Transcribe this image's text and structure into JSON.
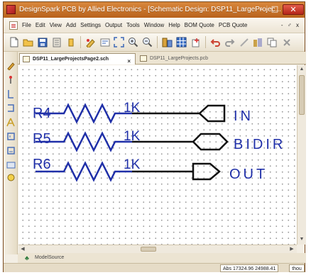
{
  "window": {
    "title": "DesignSpark PCB by Allied Electronics - [Schematic Design: DSP11_LargeProjec...",
    "minimize": "–",
    "maximize": "□",
    "close": "✕"
  },
  "menu": {
    "items": [
      "File",
      "Edit",
      "View",
      "Add",
      "Settings",
      "Output",
      "Tools",
      "Window",
      "Help",
      "BOM Quote",
      "PCB Quote"
    ],
    "mdi_controls": "- ♂ x"
  },
  "tabs": [
    {
      "label": "DSP11_LargeProjectsPage2.sch",
      "close": "×"
    },
    {
      "label": "DSP11_LargeProjects.pcb"
    }
  ],
  "schematic": {
    "resistors": [
      {
        "ref": "R4",
        "value": "1K",
        "port": "IN"
      },
      {
        "ref": "R5",
        "value": "1K",
        "port": "BIDIR"
      },
      {
        "ref": "R6",
        "value": "1K",
        "port": "OUT"
      }
    ],
    "colors": {
      "resistor": "#1f2fa8",
      "wire": "#111111",
      "port_text": "#1f2fa8",
      "grid": "#9a9a9a"
    }
  },
  "bottom_panel": {
    "tab": "ModelSource"
  },
  "status": {
    "coords": "Abs 17324.96 24988.41",
    "units": "thou"
  }
}
